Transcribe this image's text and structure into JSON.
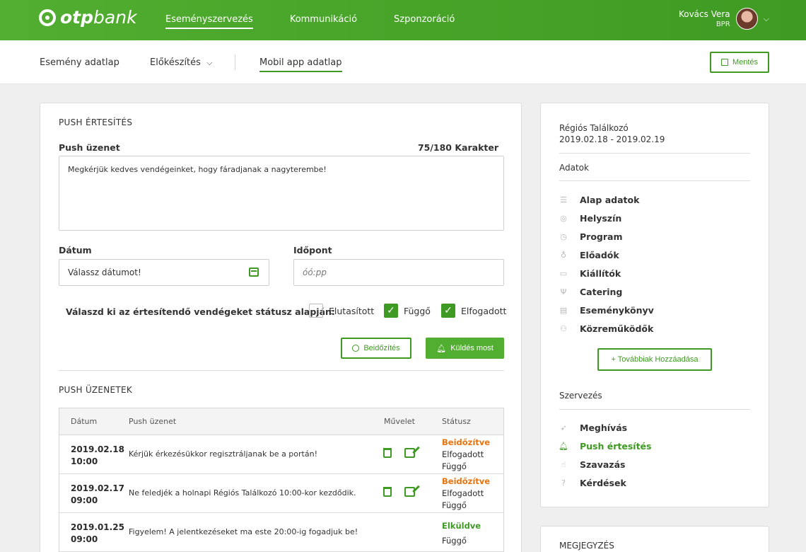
{
  "header": {
    "logo_bold": "otp",
    "logo_light": "bank",
    "nav": [
      "Eseményszervezés",
      "Kommunikáció",
      "Szponzoráció"
    ],
    "active_nav": 0,
    "user_name": "Kovács Vera",
    "user_role": "BPR"
  },
  "subnav": {
    "tabs": [
      "Esemény adatlap",
      "Előkészítés",
      "Mobil app adatlap"
    ],
    "save_label": "Mentés"
  },
  "push": {
    "title": "PUSH ÉRTESÍTÉS",
    "message_label": "Push üzenet",
    "char_count": "75/180 Karakter",
    "message_value": "Megkérjük kedves vendégeinket, hogy fáradjanak a nagyterembe!",
    "date_label": "Dátum",
    "date_placeholder": "Válassz dátumot!",
    "time_label": "Időpont",
    "time_placeholder": "óó:pp",
    "status_question": "Válaszd ki az értesítendő vendégeket státusz alapján:",
    "checkboxes": [
      {
        "label": "Elutasított",
        "checked": false
      },
      {
        "label": "Függő",
        "checked": true
      },
      {
        "label": "Elfogadott",
        "checked": true
      }
    ],
    "schedule_label": "Beidőzítés",
    "send_label": "Küldés most"
  },
  "messages": {
    "title": "PUSH ÜZENETEK",
    "columns": [
      "Dátum",
      "Push üzenet",
      "Művelet",
      "Státusz"
    ],
    "rows": [
      {
        "date": "2019.02.18",
        "time": "10:00",
        "msg": "Kérjük érkezésükkor regisztráljanak be a portán!",
        "status": "Beidőzítve",
        "status_color": "#e8730f",
        "groups": [
          "Elfogadott",
          "Függő"
        ]
      },
      {
        "date": "2019.02.17",
        "time": "09:00",
        "msg": "Ne feledjék a holnapi Régiós Találkozó 10:00-kor kezdődik.",
        "status": "Beidőzítve",
        "status_color": "#e8730f",
        "groups": [
          "Elfogadott",
          "Függő"
        ]
      },
      {
        "date": "2019.01.25",
        "time": "09:00",
        "msg": "Figyelem! A jelentkezéseket ma este 20:00-ig fogadjuk be!",
        "status": "Elküldve",
        "status_color": "#3e9a22",
        "groups": [
          "Függő"
        ]
      }
    ]
  },
  "sidebar": {
    "event_name": "Régiós Találkozó",
    "event_dates": "2019.02.18 - 2019.02.19",
    "data_heading": "Adatok",
    "data_items": [
      {
        "label": "Alap adatok",
        "icon": "list-icon"
      },
      {
        "label": "Helyszín",
        "icon": "location-pin-icon"
      },
      {
        "label": "Program",
        "icon": "clock-icon"
      },
      {
        "label": "Előadók",
        "icon": "microphone-icon"
      },
      {
        "label": "Kiállítók",
        "icon": "briefcase-icon"
      },
      {
        "label": "Catering",
        "icon": "cutlery-icon"
      },
      {
        "label": "Eseménykönyv",
        "icon": "book-icon"
      },
      {
        "label": "Közreműködők",
        "icon": "people-icon"
      }
    ],
    "add_more_label": "+ Továbbiak Hozzáadása",
    "org_heading": "Szervezés",
    "org_items": [
      {
        "label": "Meghívás",
        "icon": "paper-plane-icon",
        "active": false
      },
      {
        "label": "Push értesítés",
        "icon": "bell-icon",
        "active": true
      },
      {
        "label": "Szavazás",
        "icon": "thumbs-up-icon",
        "active": false
      },
      {
        "label": "Kérdések",
        "icon": "question-icon",
        "active": false
      }
    ],
    "notes_title": "MEGJEGYZÉS"
  },
  "colors": {
    "brand": "#52ae30",
    "brand_dark": "#3e9a22",
    "scheduled": "#e8730f"
  }
}
